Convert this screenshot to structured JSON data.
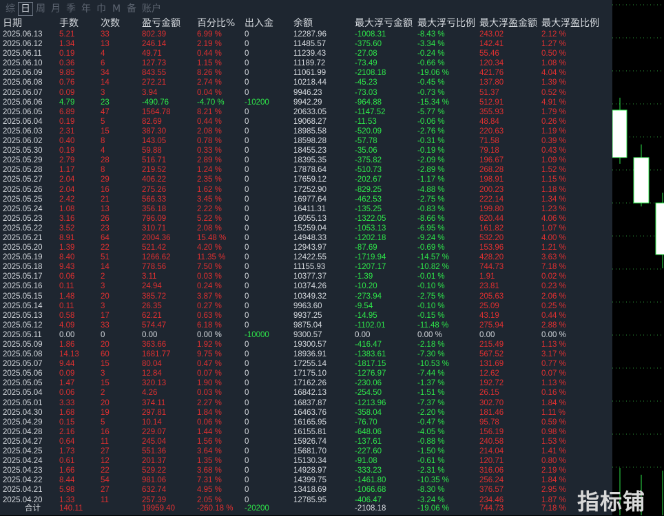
{
  "tabs": [
    "综",
    "日",
    "周",
    "月",
    "季",
    "年",
    "巾",
    "M",
    "备",
    "账户"
  ],
  "active_tab": 1,
  "headers": [
    "日期",
    "手数",
    "次数",
    "盈亏金额",
    "百分比%",
    "出入金",
    "余额",
    "最大浮亏金额",
    "最大浮亏比例",
    "最大浮盈金额",
    "最大浮盈比例"
  ],
  "rows": [
    [
      "2025.06.13",
      "5.21",
      "33",
      "802.39",
      "6.99 %",
      "0",
      "12287.96",
      "-1008.31",
      "-8.43 %",
      "243.02",
      "2.12 %"
    ],
    [
      "2025.06.12",
      "1.34",
      "13",
      "246.14",
      "2.19 %",
      "0",
      "11485.57",
      "-375.60",
      "-3.34 %",
      "142.41",
      "1.27 %"
    ],
    [
      "2025.06.11",
      "0.19",
      "4",
      "49.71",
      "0.44 %",
      "0",
      "11239.43",
      "-27.08",
      "-0.24 %",
      "55.46",
      "0.50 %"
    ],
    [
      "2025.06.10",
      "0.36",
      "6",
      "127.73",
      "1.15 %",
      "0",
      "11189.72",
      "-73.49",
      "-0.66 %",
      "120.34",
      "1.08 %"
    ],
    [
      "2025.06.09",
      "9.85",
      "34",
      "843.55",
      "8.26 %",
      "0",
      "11061.99",
      "-2108.18",
      "-19.06 %",
      "421.76",
      "4.04 %"
    ],
    [
      "2025.06.08",
      "0.76",
      "14",
      "272.21",
      "2.74 %",
      "0",
      "10218.44",
      "-45.23",
      "-0.45 %",
      "137.80",
      "1.39 %"
    ],
    [
      "2025.06.07",
      "0.09",
      "3",
      "3.94",
      "0.04 %",
      "0",
      "9946.23",
      "-73.03",
      "-0.73 %",
      "51.37",
      "0.52 %"
    ],
    [
      "2025.06.06",
      "4.79",
      "23",
      "-490.76",
      "-4.70 %",
      "-10200",
      "9942.29",
      "-964.88",
      "-15.34 %",
      "512.91",
      "4.91 %"
    ],
    [
      "2025.06.05",
      "6.89",
      "47",
      "1564.78",
      "8.21 %",
      "0",
      "20633.05",
      "-1147.52",
      "-5.77 %",
      "355.93",
      "1.79 %"
    ],
    [
      "2025.06.04",
      "0.19",
      "5",
      "82.69",
      "0.44 %",
      "0",
      "19068.27",
      "-11.53",
      "-0.06 %",
      "48.84",
      "0.26 %"
    ],
    [
      "2025.06.03",
      "2.31",
      "15",
      "387.30",
      "2.08 %",
      "0",
      "18985.58",
      "-520.09",
      "-2.76 %",
      "220.63",
      "1.19 %"
    ],
    [
      "2025.06.02",
      "0.40",
      "8",
      "143.05",
      "0.78 %",
      "0",
      "18598.28",
      "-57.78",
      "-0.31 %",
      "71.58",
      "0.39 %"
    ],
    [
      "2025.05.30",
      "0.19",
      "4",
      "59.88",
      "0.33 %",
      "0",
      "18455.23",
      "-35.06",
      "-0.19 %",
      "79.18",
      "0.43 %"
    ],
    [
      "2025.05.29",
      "2.79",
      "28",
      "516.71",
      "2.89 %",
      "0",
      "18395.35",
      "-375.82",
      "-2.09 %",
      "196.67",
      "1.09 %"
    ],
    [
      "2025.05.28",
      "1.17",
      "8",
      "219.52",
      "1.24 %",
      "0",
      "17878.64",
      "-510.73",
      "-2.89 %",
      "268.28",
      "1.52 %"
    ],
    [
      "2025.05.27",
      "2.04",
      "29",
      "406.22",
      "2.35 %",
      "0",
      "17659.12",
      "-202.67",
      "-1.17 %",
      "198.91",
      "1.15 %"
    ],
    [
      "2025.05.26",
      "2.04",
      "16",
      "275.26",
      "1.62 %",
      "0",
      "17252.90",
      "-829.25",
      "-4.88 %",
      "200.23",
      "1.18 %"
    ],
    [
      "2025.05.25",
      "2.42",
      "21",
      "566.33",
      "3.45 %",
      "0",
      "16977.64",
      "-462.53",
      "-2.75 %",
      "222.14",
      "1.34 %"
    ],
    [
      "2025.05.24",
      "1.08",
      "13",
      "356.18",
      "2.22 %",
      "0",
      "16411.31",
      "-135.25",
      "-0.83 %",
      "199.80",
      "1.23 %"
    ],
    [
      "2025.05.23",
      "3.16",
      "26",
      "796.09",
      "5.22 %",
      "0",
      "16055.13",
      "-1322.05",
      "-8.66 %",
      "620.44",
      "4.06 %"
    ],
    [
      "2025.05.22",
      "3.52",
      "23",
      "310.71",
      "2.08 %",
      "0",
      "15259.04",
      "-1053.13",
      "-6.95 %",
      "161.82",
      "1.07 %"
    ],
    [
      "2025.05.21",
      "8.91",
      "64",
      "2004.36",
      "15.48 %",
      "0",
      "14948.33",
      "-1202.18",
      "-9.24 %",
      "532.20",
      "4.00 %"
    ],
    [
      "2025.05.20",
      "1.39",
      "22",
      "521.42",
      "4.20 %",
      "0",
      "12943.97",
      "-87.69",
      "-0.69 %",
      "153.96",
      "1.21 %"
    ],
    [
      "2025.05.19",
      "8.40",
      "51",
      "1266.62",
      "11.35 %",
      "0",
      "12422.55",
      "-1719.94",
      "-14.57 %",
      "428.20",
      "3.63 %"
    ],
    [
      "2025.05.18",
      "9.43",
      "14",
      "778.56",
      "7.50 %",
      "0",
      "11155.93",
      "-1207.17",
      "-10.82 %",
      "744.73",
      "7.18 %"
    ],
    [
      "2025.05.17",
      "0.06",
      "2",
      "3.11",
      "0.03 %",
      "0",
      "10377.37",
      "-1.39",
      "-0.01 %",
      "1.91",
      "0.02 %"
    ],
    [
      "2025.05.16",
      "0.11",
      "3",
      "24.94",
      "0.24 %",
      "0",
      "10374.26",
      "-10.20",
      "-0.10 %",
      "23.81",
      "0.23 %"
    ],
    [
      "2025.05.15",
      "1.48",
      "20",
      "385.72",
      "3.87 %",
      "0",
      "10349.32",
      "-273.94",
      "-2.75 %",
      "205.63",
      "2.06 %"
    ],
    [
      "2025.05.14",
      "0.11",
      "3",
      "26.35",
      "0.27 %",
      "0",
      "9963.60",
      "-9.54",
      "-0.10 %",
      "25.09",
      "0.25 %"
    ],
    [
      "2025.05.13",
      "0.58",
      "17",
      "62.21",
      "0.63 %",
      "0",
      "9937.25",
      "-14.95",
      "-0.15 %",
      "43.19",
      "0.44 %"
    ],
    [
      "2025.05.12",
      "4.09",
      "33",
      "574.47",
      "6.18 %",
      "0",
      "9875.04",
      "-1102.01",
      "-11.48 %",
      "275.94",
      "2.88 %"
    ],
    [
      "2025.05.11",
      "0.00",
      "0",
      "0.00",
      "0.00 %",
      "-10000",
      "9300.57",
      "0.00",
      "0.00 %",
      "0.00",
      "0.00 %"
    ],
    [
      "2025.05.09",
      "1.86",
      "20",
      "363.66",
      "1.92 %",
      "0",
      "19300.57",
      "-416.47",
      "-2.18 %",
      "215.49",
      "1.13 %"
    ],
    [
      "2025.05.08",
      "14.13",
      "60",
      "1681.77",
      "9.75 %",
      "0",
      "18936.91",
      "-1383.61",
      "-7.30 %",
      "567.52",
      "3.17 %"
    ],
    [
      "2025.05.07",
      "9.44",
      "15",
      "80.04",
      "0.47 %",
      "0",
      "17255.14",
      "-1817.15",
      "-10.53 %",
      "131.69",
      "0.77 %"
    ],
    [
      "2025.05.06",
      "0.09",
      "3",
      "12.84",
      "0.07 %",
      "0",
      "17175.10",
      "-1276.97",
      "-7.44 %",
      "12.62",
      "0.07 %"
    ],
    [
      "2025.05.05",
      "1.47",
      "15",
      "320.13",
      "1.90 %",
      "0",
      "17162.26",
      "-230.06",
      "-1.37 %",
      "192.72",
      "1.13 %"
    ],
    [
      "2025.05.04",
      "0.06",
      "2",
      "4.26",
      "0.03 %",
      "0",
      "16842.13",
      "-254.50",
      "-1.51 %",
      "26.15",
      "0.16 %"
    ],
    [
      "2025.05.01",
      "3.33",
      "20",
      "374.11",
      "2.27 %",
      "0",
      "16837.87",
      "-1213.96",
      "-7.37 %",
      "302.70",
      "1.84 %"
    ],
    [
      "2025.04.30",
      "1.68",
      "19",
      "297.81",
      "1.84 %",
      "0",
      "16463.76",
      "-358.04",
      "-2.20 %",
      "181.46",
      "1.11 %"
    ],
    [
      "2025.04.29",
      "0.15",
      "5",
      "10.14",
      "0.06 %",
      "0",
      "16165.95",
      "-76.70",
      "-0.47 %",
      "95.78",
      "0.59 %"
    ],
    [
      "2025.04.28",
      "2.16",
      "16",
      "229.07",
      "1.44 %",
      "0",
      "16155.81",
      "-648.06",
      "-4.05 %",
      "156.19",
      "0.98 %"
    ],
    [
      "2025.04.27",
      "0.64",
      "11",
      "245.04",
      "1.56 %",
      "0",
      "15926.74",
      "-137.61",
      "-0.88 %",
      "240.58",
      "1.53 %"
    ],
    [
      "2025.04.25",
      "1.73",
      "27",
      "551.36",
      "3.64 %",
      "0",
      "15681.70",
      "-227.60",
      "-1.50 %",
      "214.04",
      "1.41 %"
    ],
    [
      "2025.04.24",
      "0.61",
      "12",
      "201.37",
      "1.35 %",
      "0",
      "15130.34",
      "-91.08",
      "-0.61 %",
      "120.71",
      "0.80 %"
    ],
    [
      "2025.04.23",
      "1.66",
      "22",
      "529.22",
      "3.68 %",
      "0",
      "14928.97",
      "-333.23",
      "-2.31 %",
      "316.06",
      "2.19 %"
    ],
    [
      "2025.04.22",
      "8.44",
      "54",
      "981.06",
      "7.31 %",
      "0",
      "14399.75",
      "-1461.80",
      "-10.35 %",
      "256.24",
      "1.84 %"
    ],
    [
      "2025.04.21",
      "5.98",
      "27",
      "632.74",
      "4.95 %",
      "0",
      "13418.69",
      "-1066.68",
      "-8.30 %",
      "376.57",
      "2.95 %"
    ],
    [
      "2025.04.20",
      "1.33",
      "11",
      "257.39",
      "2.05 %",
      "0",
      "12785.95",
      "-406.47",
      "-3.24 %",
      "234.46",
      "1.87 %"
    ]
  ],
  "footer": {
    "label": "合计",
    "lots": "140.11",
    "pnl": "19959.40",
    "pct": "-260.18 %",
    "flow": "-20200",
    "max_loss": "-2108.18",
    "max_loss_pct": "-19.06 %",
    "max_gain": "744.73",
    "max_gain_pct": "7.18 %"
  },
  "watermark": "指标铺",
  "colors": {
    "panel_bg": "#1e2630",
    "positive": "#e03030",
    "negative": "#2ee64a",
    "neutral": "#d5d9de",
    "chart_bg": "#000000",
    "candle_up": "#2ee64a"
  }
}
